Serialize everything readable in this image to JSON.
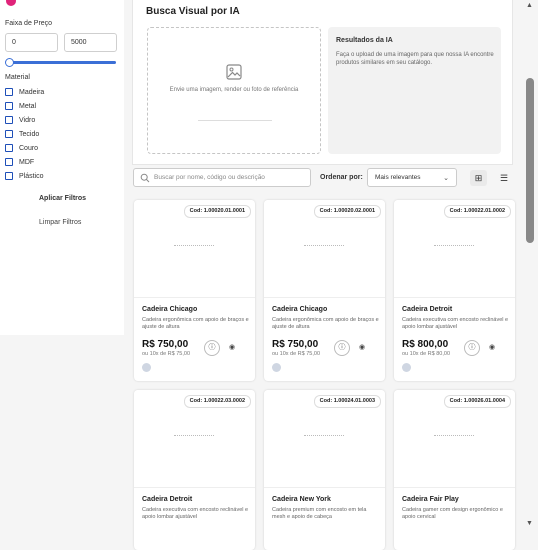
{
  "sidebar": {
    "price_label": "Faixa de Preço",
    "price_min": "0",
    "price_max": "5000",
    "material_label": "Material",
    "materials": [
      "Madeira",
      "Metal",
      "Vidro",
      "Tecido",
      "Couro",
      "MDF",
      "Plástico"
    ],
    "apply_label": "Aplicar Filtros",
    "clear_label": "Limpar Filtros"
  },
  "ai": {
    "title": "Busca Visual por IA",
    "upload_text": "Envie uma imagem, render ou foto de referência",
    "results_title": "Resultados da IA",
    "results_desc": "Faça o upload de uma imagem para que nossa IA encontre produtos similares em seu catálogo."
  },
  "toolbar": {
    "search_placeholder": "Buscar por nome, código ou descrição",
    "sort_label": "Ordenar por:",
    "sort_value": "Mais relevantes"
  },
  "icons": {
    "image": "image-icon",
    "search": "search-icon",
    "grid": "grid-view-icon",
    "list": "list-view-icon",
    "info": "info-icon",
    "view": "eye-icon"
  },
  "colors": {
    "accent": "#e0237a",
    "primary": "#3b6fd6"
  },
  "products": [
    {
      "code": "Cod: 1.00020.01.0001",
      "name": "Cadeira Chicago",
      "desc": "Cadeira ergonômica com apoio de braços e ajuste de altura",
      "price": "R$ 750,00",
      "installments": "ou 10x de R$ 75,00"
    },
    {
      "code": "Cod: 1.00020.02.0001",
      "name": "Cadeira Chicago",
      "desc": "Cadeira ergonômica com apoio de braços e ajuste de altura",
      "price": "R$ 750,00",
      "installments": "ou 10x de R$ 75,00"
    },
    {
      "code": "Cod: 1.00022.01.0002",
      "name": "Cadeira Detroit",
      "desc": "Cadeira executiva com encosto reclinável e apoio lombar ajustável",
      "price": "R$ 800,00",
      "installments": "ou 10x de R$ 80,00"
    },
    {
      "code": "Cod: 1.00022.03.0002",
      "name": "Cadeira Detroit",
      "desc": "Cadeira executiva com encosto reclinável e apoio lombar ajustável",
      "price": "",
      "installments": ""
    },
    {
      "code": "Cod: 1.00024.01.0003",
      "name": "Cadeira New York",
      "desc": "Cadeira premium com encosto em tela mesh e apoio de cabeça",
      "price": "",
      "installments": ""
    },
    {
      "code": "Cod: 1.00026.01.0004",
      "name": "Cadeira Fair Play",
      "desc": "Cadeira gamer com design ergonômico e apoio cervical",
      "price": "",
      "installments": ""
    }
  ]
}
